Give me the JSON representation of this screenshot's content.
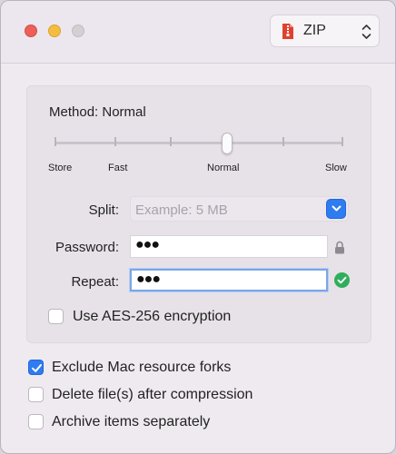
{
  "titlebar": {
    "format": {
      "label": "ZIP",
      "icon": "zip-file-icon",
      "icon_color": "#e0412f"
    }
  },
  "method": {
    "prefix": "Method:",
    "value": "Normal",
    "slider_labels": [
      "Store",
      "Fast",
      "Normal",
      "Slow"
    ],
    "level": 3,
    "steps": 6
  },
  "fields": {
    "split": {
      "label": "Split:",
      "placeholder": "Example: 5 MB"
    },
    "password": {
      "label": "Password:",
      "value": "●●●"
    },
    "repeat": {
      "label": "Repeat:",
      "value": "●●●"
    }
  },
  "options": {
    "aes": {
      "label": "Use AES-256 encryption",
      "checked": false
    },
    "exclude_forks": {
      "label": "Exclude Mac resource forks",
      "checked": true
    },
    "delete_after": {
      "label": "Delete file(s) after compression",
      "checked": false
    },
    "separately": {
      "label": "Archive items separately",
      "checked": false
    }
  },
  "colors": {
    "accent": "#2f7bf0",
    "success": "#2fae5b"
  }
}
